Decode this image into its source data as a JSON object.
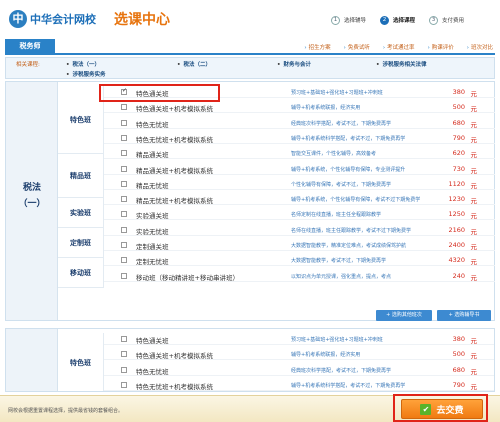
{
  "header": {
    "logo_mark": "中",
    "logo_text": "中华会计网校",
    "logo_sub": "选课中心",
    "steps": [
      {
        "num": "1",
        "label": "选择辅导"
      },
      {
        "num": "2",
        "label": "选择课程"
      },
      {
        "num": "3",
        "label": "支付费用"
      }
    ]
  },
  "tabbar": {
    "main_tab": "税务师",
    "links": [
      "招生方案",
      "免费试听",
      "考试通过率",
      "购课评价",
      "班次对比"
    ]
  },
  "related": {
    "label": "相关课程:",
    "links": [
      "税法（一）",
      "税法（二）",
      "财务与会计",
      "涉税服务相关法律",
      "涉税服务实务"
    ]
  },
  "subject1": {
    "line1": "税法",
    "line2": "（一）"
  },
  "categories": [
    "特色班",
    "精品班",
    "实验班",
    "定制班",
    "移动班"
  ],
  "rows": [
    {
      "name": "特色通关班",
      "desc": "预习班+基础班+强化班+习题班+冲刺班",
      "price": "380",
      "unit": "元",
      "checked": true
    },
    {
      "name": "特色通关班+机考模拟系统",
      "desc": "辅导+机考系统联报，经济实用",
      "price": "500",
      "unit": "元",
      "checked": false
    },
    {
      "name": "特色无忧班",
      "desc": "经典班次科学搭配，考试不过，下期免费再学",
      "price": "680",
      "unit": "元",
      "checked": false
    },
    {
      "name": "特色无忧班+机考模拟系统",
      "desc": "辅导+机考系统科学搭配，考试不过，下期免费再学",
      "price": "790",
      "unit": "元",
      "checked": false
    },
    {
      "name": "精品通关班",
      "desc": "智能交互课件，个性化辅导，高效备考",
      "price": "620",
      "unit": "元",
      "checked": false
    },
    {
      "name": "精品通关班+机考模拟系统",
      "desc": "辅导+机考系统，个性化辅导有保障，专业测评提升",
      "price": "730",
      "unit": "元",
      "checked": false
    },
    {
      "name": "精品无忧班",
      "desc": "个性化辅导有保障，考试不过，下期免费再学",
      "price": "1120",
      "unit": "元",
      "checked": false
    },
    {
      "name": "精品无忧班+机考模拟系统",
      "desc": "辅导+机考系统，个性化辅导有保障，考试不过下期免费学",
      "price": "1230",
      "unit": "元",
      "checked": false
    },
    {
      "name": "实验通关班",
      "desc": "名师定制在线直播，班主任全程跟踪教学",
      "price": "1250",
      "unit": "元",
      "checked": false
    },
    {
      "name": "实验无忧班",
      "desc": "名师在线直播，班主任跟踪教学，考试不过下期免费学",
      "price": "2160",
      "unit": "元",
      "checked": false
    },
    {
      "name": "定制通关班",
      "desc": "大数据智能教学，精准定位难点，考试成绩保驾护航",
      "price": "2400",
      "unit": "元",
      "checked": false
    },
    {
      "name": "定制无忧班",
      "desc": "大数据智能教学，考试不过，下期免费再学",
      "price": "4320",
      "unit": "元",
      "checked": false
    },
    {
      "name": "移动班（移动精讲班+移动串讲班）",
      "desc": "以知识点为单元授课，强化重点，提点，考点",
      "price": "240",
      "unit": "元",
      "checked": false
    }
  ],
  "actions": {
    "compare": "选购其他班次",
    "study": "选购辅导书"
  },
  "categories2": [
    "特色班"
  ],
  "rows2": [
    {
      "name": "特色通关班",
      "desc": "预习班+基础班+强化班+习题班+冲刺班",
      "price": "380",
      "unit": "元",
      "checked": false
    },
    {
      "name": "特色通关班+机考模拟系统",
      "desc": "辅导+机考系统联报，经济实用",
      "price": "500",
      "unit": "元",
      "checked": false
    },
    {
      "name": "特色无忧班",
      "desc": "经典班次科学搭配，考试不过，下期免费再学",
      "price": "680",
      "unit": "元",
      "checked": false
    },
    {
      "name": "特色无忧班+机考模拟系统",
      "desc": "辅导+机考系统科学搭配，考试不过，下期免费再学",
      "price": "790",
      "unit": "元",
      "checked": false
    }
  ],
  "footer": {
    "tip": "网校会根据重置课程选择，提供最省钱的套餐组合。",
    "pay_label": "去交费",
    "pay_icon": "check-icon"
  },
  "colors": {
    "brand_blue": "#2a82c8",
    "accent_orange": "#f07a12",
    "price_red": "#d42b1e",
    "highlight_red": "#e02419"
  }
}
